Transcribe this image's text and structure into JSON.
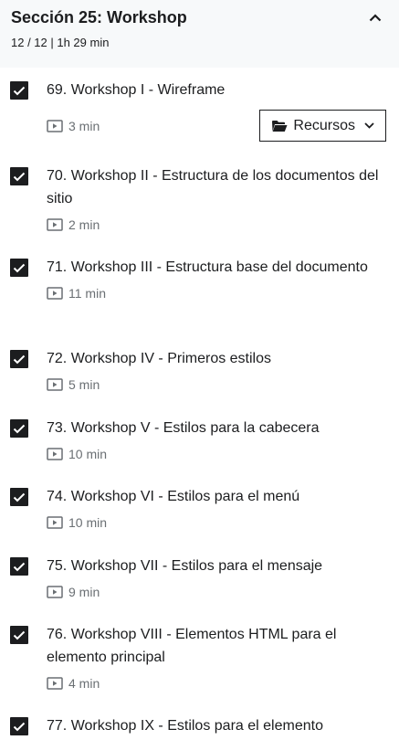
{
  "section": {
    "title": "Sección 25: Workshop",
    "meta": "12 / 12 | 1h 29 min"
  },
  "lectures": [
    {
      "title": "69. Workshop I - Wireframe",
      "duration": "3 min",
      "completed": true,
      "resources_label": "Recursos"
    },
    {
      "title": "70. Workshop II - Estructura de los documentos del sitio",
      "duration": "2 min",
      "completed": true
    },
    {
      "title": "71. Workshop III - Estructura base del documento",
      "duration": "11 min",
      "completed": true
    },
    {
      "title": "72. Workshop IV - Primeros estilos",
      "duration": "5 min",
      "completed": true
    },
    {
      "title": "73. Workshop V - Estilos para la cabecera",
      "duration": "10 min",
      "completed": true
    },
    {
      "title": "74. Workshop VI - Estilos para el menú",
      "duration": "10 min",
      "completed": true
    },
    {
      "title": "75. Workshop VII - Estilos para el mensaje",
      "duration": "9 min",
      "completed": true
    },
    {
      "title": "76. Workshop VIII - Elementos HTML para el elemento principal",
      "duration": "4 min",
      "completed": true
    },
    {
      "title": "77. Workshop IX - Estilos para el elemento",
      "duration": "",
      "completed": true
    }
  ],
  "colors": {
    "checkbox": "#1c1d1f",
    "header_bg": "#f7f9fa",
    "meta_text": "#6a6f73"
  },
  "icons": {
    "collapse": "chevron-up-icon",
    "check": "check-icon",
    "video": "video-icon",
    "folder": "folder-open-icon",
    "dropdown": "chevron-down-icon"
  }
}
